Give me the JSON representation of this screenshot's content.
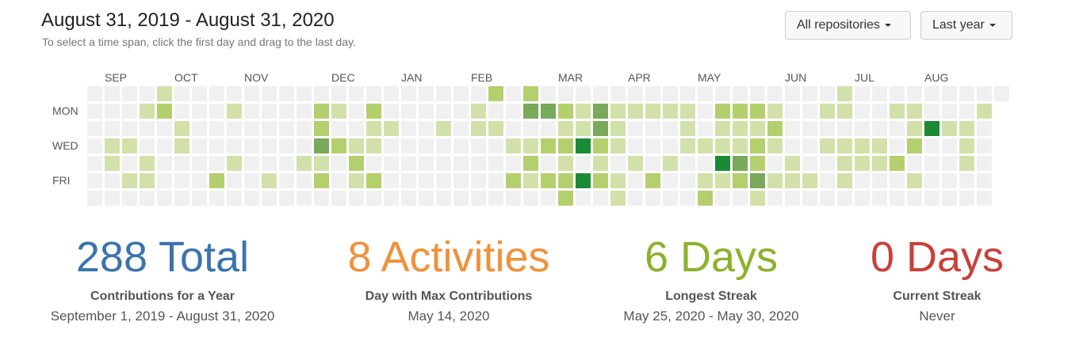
{
  "header": {
    "title": "August 31, 2019 - August 31, 2020",
    "subtitle": "To select a time span, click the first day and drag to the last day."
  },
  "controls": {
    "repos_label": "All repositories",
    "period_label": "Last year"
  },
  "calendar": {
    "months": [
      {
        "label": "SEP",
        "week": 1
      },
      {
        "label": "OCT",
        "week": 5
      },
      {
        "label": "NOV",
        "week": 9
      },
      {
        "label": "DEC",
        "week": 14
      },
      {
        "label": "JAN",
        "week": 18
      },
      {
        "label": "FEB",
        "week": 22
      },
      {
        "label": "MAR",
        "week": 27
      },
      {
        "label": "APR",
        "week": 31
      },
      {
        "label": "MAY",
        "week": 35
      },
      {
        "label": "JUN",
        "week": 40
      },
      {
        "label": "JUL",
        "week": 44
      },
      {
        "label": "AUG",
        "week": 48
      }
    ],
    "day_labels": [
      {
        "label": "MON",
        "row": 1
      },
      {
        "label": "WED",
        "row": 3
      },
      {
        "label": "FRI",
        "row": 5
      }
    ],
    "colors": [
      "#eeeeee",
      "#d6e685",
      "#8cc665",
      "#44a340",
      "#1e6823"
    ],
    "level_colors": [
      "#f0f0f0",
      "#d2e1a9",
      "#b4cf6d",
      "#79a95b",
      "#1b8a34"
    ],
    "weeks": 53,
    "levels": [
      [
        0,
        0,
        0,
        0,
        0,
        0,
        0,
        0,
        0,
        0,
        0,
        0,
        0,
        0,
        0,
        0,
        0,
        0,
        0,
        0,
        0,
        0,
        0,
        0,
        0,
        0,
        0,
        0,
        0,
        0,
        0,
        0,
        0,
        0,
        0,
        0,
        0,
        0,
        0,
        0,
        0,
        0,
        0,
        0,
        0,
        0,
        0,
        0,
        0,
        0,
        0,
        0,
        0
      ],
      [
        0,
        0,
        0,
        0,
        0,
        0,
        0,
        0,
        0,
        0,
        0,
        0,
        0,
        0,
        0,
        0,
        0,
        0,
        0,
        0,
        0,
        0,
        0,
        0,
        0,
        0,
        0,
        0,
        0,
        0,
        0,
        0,
        0,
        0,
        0,
        0,
        0,
        0,
        0,
        0,
        0,
        0,
        0,
        0,
        0,
        0,
        0,
        0,
        0,
        0,
        0,
        0,
        0
      ],
      [
        0,
        0,
        0,
        0,
        0,
        0,
        0,
        0,
        0,
        0,
        0,
        0,
        0,
        0,
        0,
        0,
        0,
        0,
        0,
        0,
        0,
        0,
        0,
        0,
        0,
        0,
        0,
        0,
        0,
        0,
        0,
        0,
        0,
        0,
        0,
        0,
        0,
        0,
        0,
        0,
        0,
        0,
        0,
        0,
        0,
        0,
        0,
        0,
        0,
        0,
        0,
        0,
        0
      ],
      [
        0,
        0,
        0,
        0,
        0,
        0,
        0,
        0,
        0,
        0,
        0,
        0,
        0,
        0,
        0,
        0,
        0,
        0,
        0,
        0,
        0,
        0,
        0,
        0,
        0,
        0,
        0,
        0,
        0,
        0,
        0,
        0,
        0,
        0,
        0,
        0,
        0,
        0,
        0,
        0,
        0,
        0,
        0,
        0,
        0,
        0,
        0,
        0,
        0,
        0,
        0,
        0,
        0
      ],
      [
        0,
        0,
        0,
        0,
        0,
        0,
        0,
        0,
        0,
        0,
        0,
        0,
        0,
        0,
        0,
        0,
        0,
        0,
        0,
        0,
        0,
        0,
        0,
        0,
        0,
        0,
        0,
        0,
        0,
        0,
        0,
        0,
        0,
        0,
        0,
        0,
        0,
        0,
        0,
        0,
        0,
        0,
        0,
        0,
        0,
        0,
        0,
        0,
        0,
        0,
        0,
        0,
        0
      ],
      [
        0,
        0,
        0,
        0,
        0,
        0,
        0,
        0,
        0,
        0,
        0,
        0,
        0,
        0,
        0,
        0,
        0,
        0,
        0,
        0,
        0,
        0,
        0,
        0,
        0,
        0,
        0,
        0,
        0,
        0,
        0,
        0,
        0,
        0,
        0,
        0,
        0,
        0,
        0,
        0,
        0,
        0,
        0,
        0,
        0,
        0,
        0,
        0,
        0,
        0,
        0,
        0,
        0
      ],
      [
        0,
        0,
        0,
        0,
        0,
        0,
        0,
        0,
        0,
        0,
        0,
        0,
        0,
        0,
        0,
        0,
        0,
        0,
        0,
        0,
        0,
        0,
        0,
        0,
        0,
        0,
        0,
        0,
        0,
        0,
        0,
        0,
        0,
        0,
        0,
        0,
        0,
        0,
        0,
        0,
        0,
        0,
        0,
        0,
        0,
        0,
        0,
        0,
        0,
        0,
        0,
        0,
        0
      ]
    ],
    "active": [
      [
        0,
        4,
        1
      ],
      [
        0,
        23,
        2
      ],
      [
        0,
        25,
        2
      ],
      [
        0,
        43,
        1
      ],
      [
        1,
        3,
        1
      ],
      [
        1,
        4,
        2
      ],
      [
        1,
        8,
        1
      ],
      [
        1,
        13,
        2
      ],
      [
        1,
        14,
        1
      ],
      [
        1,
        16,
        2
      ],
      [
        1,
        22,
        1
      ],
      [
        1,
        25,
        3
      ],
      [
        1,
        26,
        3
      ],
      [
        1,
        27,
        2
      ],
      [
        1,
        28,
        1
      ],
      [
        1,
        29,
        3
      ],
      [
        1,
        30,
        1
      ],
      [
        1,
        31,
        1
      ],
      [
        1,
        32,
        1
      ],
      [
        1,
        33,
        1
      ],
      [
        1,
        34,
        1
      ],
      [
        1,
        36,
        2
      ],
      [
        1,
        37,
        2
      ],
      [
        1,
        38,
        2
      ],
      [
        1,
        39,
        1
      ],
      [
        1,
        42,
        1
      ],
      [
        1,
        43,
        1
      ],
      [
        1,
        46,
        1
      ],
      [
        1,
        47,
        1
      ],
      [
        1,
        51,
        1
      ],
      [
        2,
        5,
        1
      ],
      [
        2,
        13,
        2
      ],
      [
        2,
        16,
        1
      ],
      [
        2,
        17,
        1
      ],
      [
        2,
        20,
        1
      ],
      [
        2,
        22,
        1
      ],
      [
        2,
        23,
        1
      ],
      [
        2,
        27,
        1
      ],
      [
        2,
        28,
        1
      ],
      [
        2,
        29,
        3
      ],
      [
        2,
        30,
        1
      ],
      [
        2,
        34,
        1
      ],
      [
        2,
        36,
        1
      ],
      [
        2,
        37,
        1
      ],
      [
        2,
        38,
        1
      ],
      [
        2,
        39,
        2
      ],
      [
        2,
        47,
        1
      ],
      [
        2,
        48,
        4
      ],
      [
        2,
        49,
        1
      ],
      [
        2,
        50,
        1
      ],
      [
        3,
        1,
        1
      ],
      [
        3,
        2,
        1
      ],
      [
        3,
        5,
        1
      ],
      [
        3,
        13,
        3
      ],
      [
        3,
        14,
        2
      ],
      [
        3,
        15,
        1
      ],
      [
        3,
        16,
        1
      ],
      [
        3,
        24,
        1
      ],
      [
        3,
        25,
        1
      ],
      [
        3,
        26,
        2
      ],
      [
        3,
        27,
        2
      ],
      [
        3,
        28,
        4
      ],
      [
        3,
        29,
        2
      ],
      [
        3,
        30,
        1
      ],
      [
        3,
        34,
        1
      ],
      [
        3,
        35,
        1
      ],
      [
        3,
        36,
        1
      ],
      [
        3,
        37,
        1
      ],
      [
        3,
        38,
        2
      ],
      [
        3,
        39,
        1
      ],
      [
        3,
        42,
        1
      ],
      [
        3,
        43,
        1
      ],
      [
        3,
        44,
        1
      ],
      [
        3,
        45,
        1
      ],
      [
        3,
        47,
        2
      ],
      [
        3,
        50,
        1
      ],
      [
        4,
        1,
        1
      ],
      [
        4,
        3,
        1
      ],
      [
        4,
        8,
        1
      ],
      [
        4,
        12,
        1
      ],
      [
        4,
        13,
        1
      ],
      [
        4,
        15,
        2
      ],
      [
        4,
        25,
        2
      ],
      [
        4,
        27,
        1
      ],
      [
        4,
        29,
        1
      ],
      [
        4,
        31,
        1
      ],
      [
        4,
        33,
        1
      ],
      [
        4,
        36,
        4
      ],
      [
        4,
        37,
        3
      ],
      [
        4,
        38,
        2
      ],
      [
        4,
        40,
        1
      ],
      [
        4,
        43,
        1
      ],
      [
        4,
        44,
        1
      ],
      [
        4,
        45,
        1
      ],
      [
        4,
        46,
        2
      ],
      [
        4,
        50,
        1
      ],
      [
        5,
        2,
        1
      ],
      [
        5,
        3,
        1
      ],
      [
        5,
        7,
        2
      ],
      [
        5,
        10,
        1
      ],
      [
        5,
        13,
        2
      ],
      [
        5,
        15,
        1
      ],
      [
        5,
        16,
        2
      ],
      [
        5,
        24,
        2
      ],
      [
        5,
        25,
        1
      ],
      [
        5,
        26,
        2
      ],
      [
        5,
        27,
        2
      ],
      [
        5,
        28,
        4
      ],
      [
        5,
        29,
        2
      ],
      [
        5,
        30,
        1
      ],
      [
        5,
        32,
        2
      ],
      [
        5,
        35,
        1
      ],
      [
        5,
        36,
        1
      ],
      [
        5,
        37,
        2
      ],
      [
        5,
        38,
        3
      ],
      [
        5,
        39,
        1
      ],
      [
        5,
        40,
        1
      ],
      [
        5,
        41,
        1
      ],
      [
        5,
        43,
        1
      ],
      [
        5,
        47,
        1
      ],
      [
        6,
        27,
        2
      ],
      [
        6,
        30,
        1
      ],
      [
        6,
        35,
        2
      ],
      [
        6,
        38,
        1
      ]
    ]
  },
  "stats": [
    {
      "value": "288 Total",
      "label": "Contributions for a Year",
      "sub": "September 1, 2019 - August 31, 2020",
      "color": "#3b74ad"
    },
    {
      "value": "8 Activities",
      "label": "Day with Max Contributions",
      "sub": "May 14, 2020",
      "color": "#f0913a"
    },
    {
      "value": "6 Days",
      "label": "Longest Streak",
      "sub": "May 25, 2020 - May 30, 2020",
      "color": "#8cb22d"
    },
    {
      "value": "0 Days",
      "label": "Current Streak",
      "sub": "Never",
      "color": "#c9413a"
    }
  ]
}
